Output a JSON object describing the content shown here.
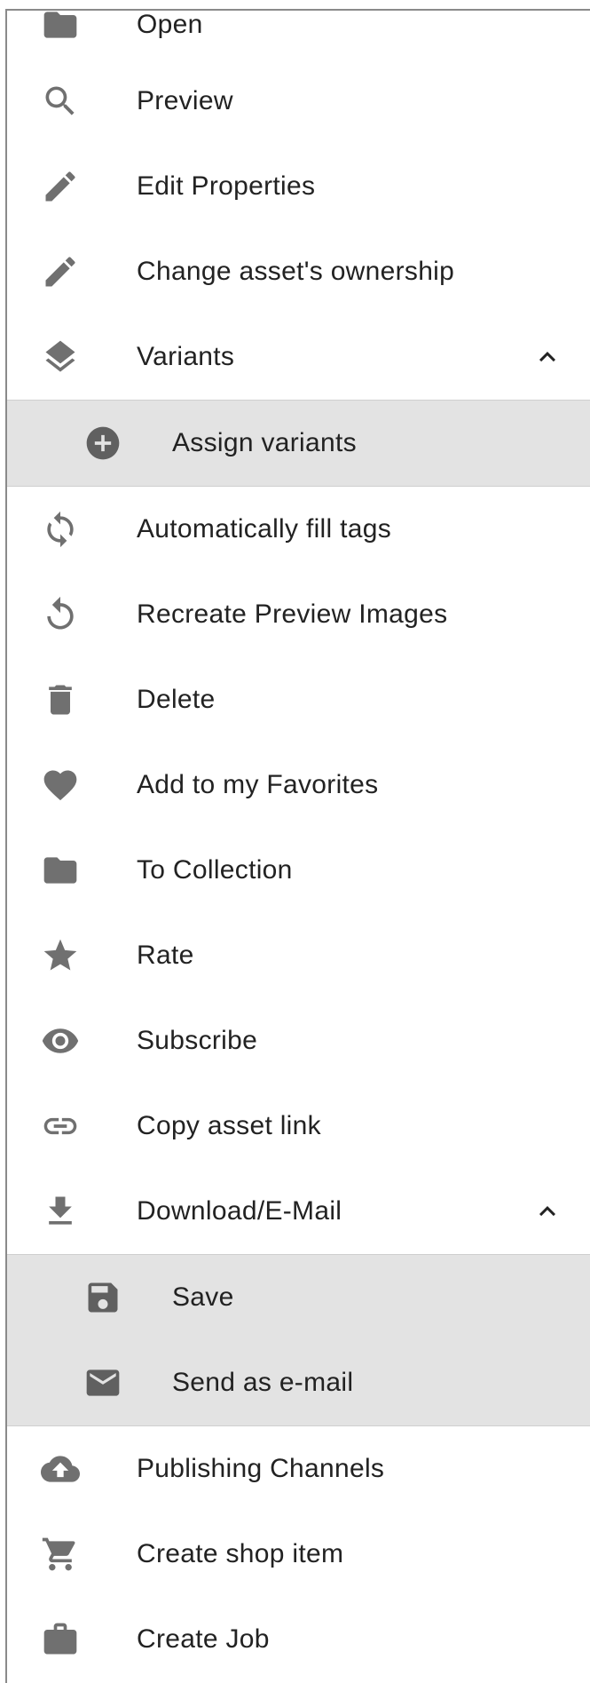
{
  "menu": {
    "open": "Open",
    "preview": "Preview",
    "edit_properties": "Edit Properties",
    "change_ownership": "Change asset's ownership",
    "variants": "Variants",
    "assign_variants": "Assign variants",
    "auto_fill_tags": "Automatically fill tags",
    "recreate_preview": "Recreate Preview Images",
    "delete": "Delete",
    "add_favorites": "Add to my Favorites",
    "to_collection": "To Collection",
    "rate": "Rate",
    "subscribe": "Subscribe",
    "copy_link": "Copy asset link",
    "download_email": "Download/E-Mail",
    "save": "Save",
    "send_email": "Send as e-mail",
    "publishing_channels": "Publishing Channels",
    "create_shop_item": "Create shop item",
    "create_job": "Create Job"
  },
  "icons": {
    "open": "folder-icon",
    "preview": "search-icon",
    "edit_properties": "pencil-icon",
    "change_ownership": "pencil-icon",
    "variants": "layers-icon",
    "assign_variants": "add-circle-icon",
    "auto_fill_tags": "sync-icon",
    "recreate_preview": "replay-icon",
    "delete": "trash-icon",
    "add_favorites": "heart-icon",
    "to_collection": "folder-icon",
    "rate": "star-icon",
    "subscribe": "eye-icon",
    "copy_link": "link-icon",
    "download_email": "download-icon",
    "save": "floppy-disk-icon",
    "send_email": "mail-icon",
    "publishing_channels": "cloud-upload-icon",
    "create_shop_item": "cart-icon",
    "create_job": "briefcase-icon"
  },
  "colors": {
    "icon": "#707070",
    "submenu_background": "#e3e3e3",
    "text": "#222222"
  }
}
